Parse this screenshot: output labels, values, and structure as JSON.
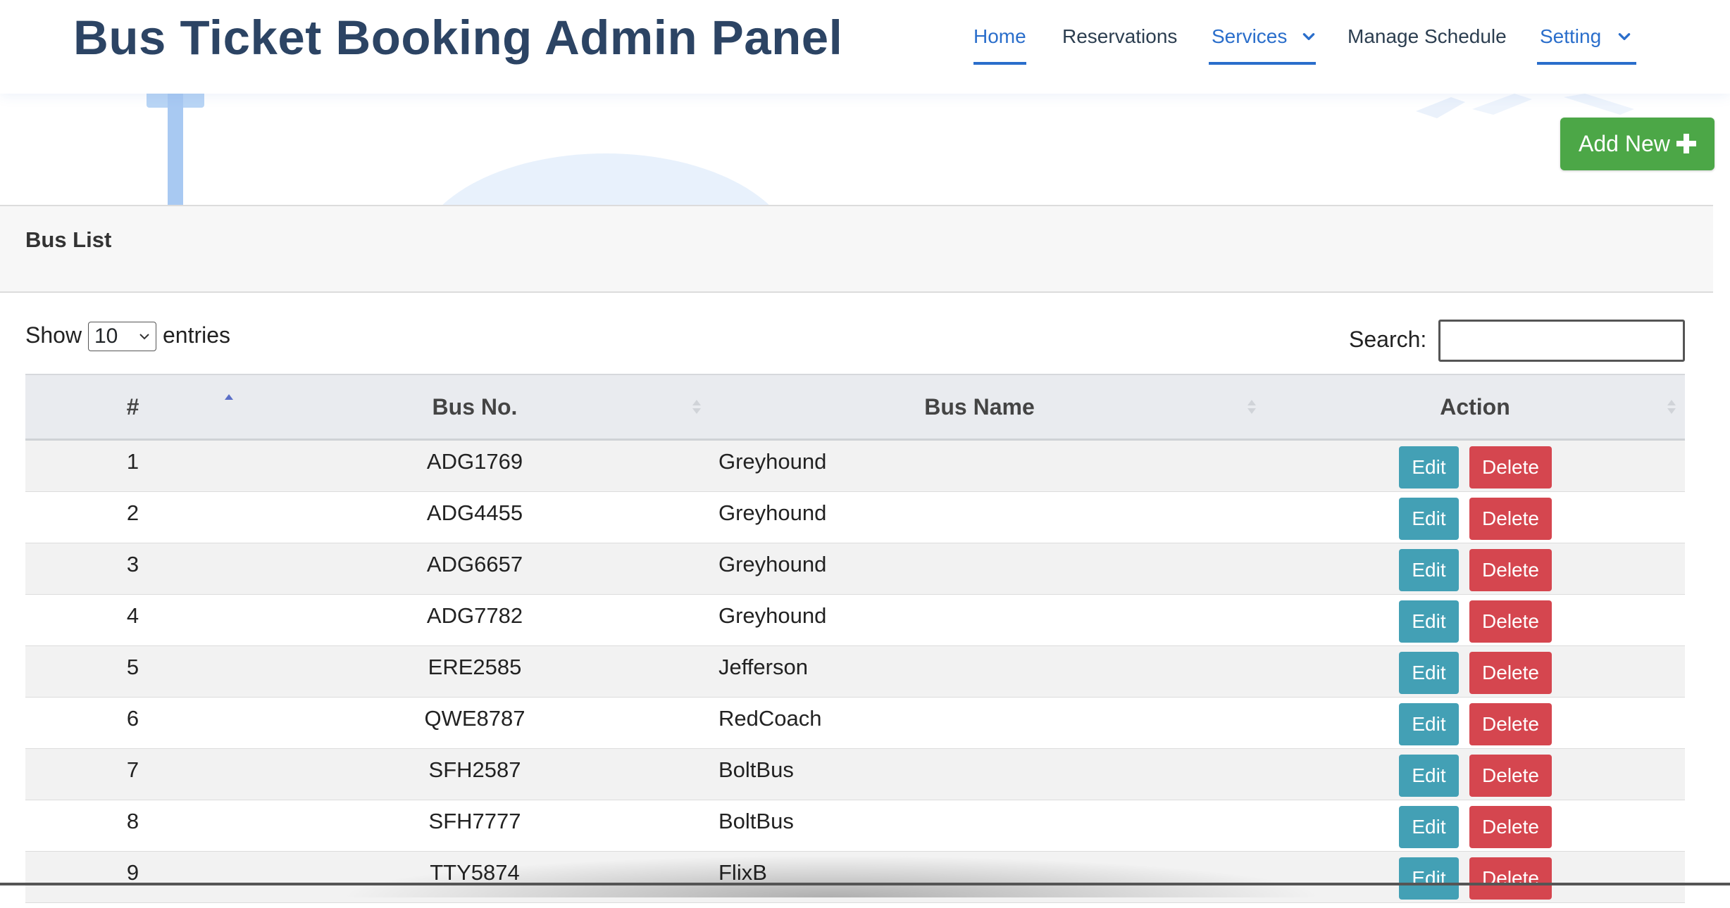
{
  "brand": {
    "title": "Bus Ticket Booking Admin Panel"
  },
  "nav": {
    "items": [
      {
        "label": "Home",
        "active": true,
        "dropdown": false
      },
      {
        "label": "Reservations",
        "active": false,
        "dropdown": false
      },
      {
        "label": "Services",
        "active": true,
        "dropdown": true
      },
      {
        "label": "Manage Schedule",
        "active": false,
        "dropdown": false
      },
      {
        "label": "Setting",
        "active": true,
        "dropdown": true
      }
    ]
  },
  "toolbar": {
    "add_new_label": "Add New",
    "add_new_icon": "plus-icon",
    "add_new_color": "#4ca747"
  },
  "card": {
    "title": "Bus List"
  },
  "length_menu": {
    "show_label": "Show",
    "selected": "10",
    "entries_label": "entries"
  },
  "search": {
    "label": "Search:",
    "value": ""
  },
  "table": {
    "columns": [
      "#",
      "Bus No.",
      "Bus Name",
      "Action"
    ],
    "sorted_column": "#",
    "sort_direction": "ascending",
    "rows": [
      {
        "num": "1",
        "bus_no": "ADG1769",
        "bus_name": "Greyhound"
      },
      {
        "num": "2",
        "bus_no": "ADG4455",
        "bus_name": "Greyhound"
      },
      {
        "num": "3",
        "bus_no": "ADG6657",
        "bus_name": "Greyhound"
      },
      {
        "num": "4",
        "bus_no": "ADG7782",
        "bus_name": "Greyhound"
      },
      {
        "num": "5",
        "bus_no": "ERE2585",
        "bus_name": "Jefferson"
      },
      {
        "num": "6",
        "bus_no": "QWE8787",
        "bus_name": "RedCoach"
      },
      {
        "num": "7",
        "bus_no": "SFH2587",
        "bus_name": "BoltBus"
      },
      {
        "num": "8",
        "bus_no": "SFH7777",
        "bus_name": "BoltBus"
      },
      {
        "num": "9",
        "bus_no": "TTY5874",
        "bus_name": "FlixB"
      }
    ],
    "edit_label": "Edit",
    "delete_label": "Delete",
    "edit_color": "#43a0b5",
    "delete_color": "#d5464f"
  },
  "colors": {
    "brand_text": "#2c4464",
    "nav_active": "#2a6ecb"
  }
}
